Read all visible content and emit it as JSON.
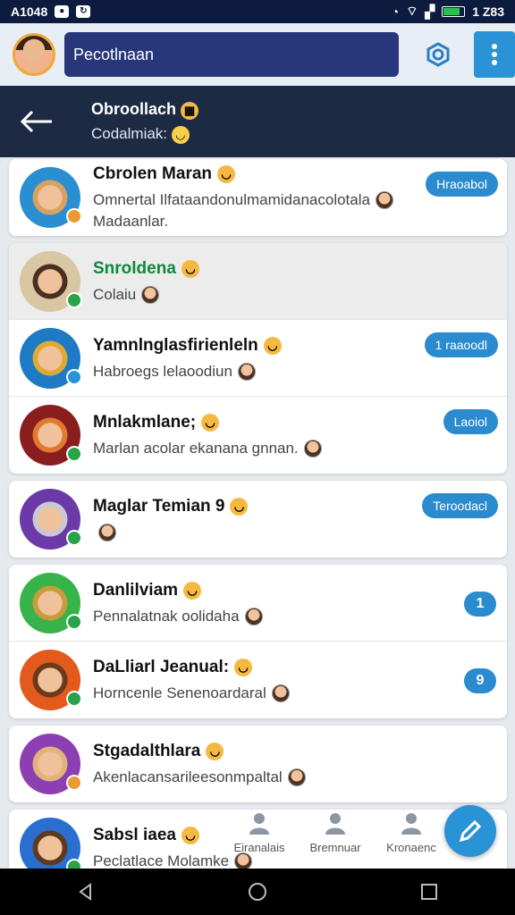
{
  "status_bar": {
    "time": "A1048",
    "right_text": "1 Z83"
  },
  "top_bar": {
    "search_value": "Pecotlnaan"
  },
  "sub_header": {
    "title": "Obroollach",
    "subtitle": "Codalmiak:"
  },
  "groups": [
    [
      {
        "name": "Cbrolen Maran",
        "preview": "Omnertal Ilfataandonulmamidanacolotala",
        "second_line": "Madaanlar.",
        "pill": "Hraoabol",
        "avatar_colors": [
          "#2a8fd0",
          "#d8a160"
        ],
        "badge": "#e99a33"
      }
    ],
    [
      {
        "name": "Snroldena",
        "preview": "Colaiu",
        "selected": true,
        "green": true,
        "avatar_colors": [
          "#d9c6a3",
          "#4a3020"
        ],
        "badge": "#2aa24a"
      },
      {
        "name": "Yamnlnglasfirienleln",
        "preview": "Habroegs lelaoodiun",
        "pill": "1 raaoodl",
        "avatar_colors": [
          "#1e7ac4",
          "#e0a933"
        ],
        "badge": "#2a93d5"
      },
      {
        "name": "Mnlakmlane;",
        "preview": "Marlan acolar ekanana gnnan.",
        "pill": "Laoiol",
        "avatar_colors": [
          "#8a1e1e",
          "#e07a30"
        ],
        "badge": "#2aa24a"
      }
    ],
    [
      {
        "name": "Maglar Temian 9",
        "preview": "",
        "pill": "Teroodacl",
        "avatar_colors": [
          "#6c3aa8",
          "#c9c9d4"
        ],
        "badge": "#2aa24a"
      }
    ],
    [
      {
        "name": "Danlilviam",
        "preview": "Pennalatnak oolidaha",
        "pill": "1",
        "pill_round": true,
        "avatar_colors": [
          "#38b24a",
          "#c79c3b"
        ],
        "badge": "#2aa24a"
      },
      {
        "name": "DaLliarl Jeanual:",
        "preview": "Horncenle Senenoardaral",
        "pill": "9",
        "pill_round": true,
        "avatar_colors": [
          "#e25a1c",
          "#6b3a1c"
        ],
        "badge": "#2aa24a"
      }
    ],
    [
      {
        "name": "Stgadalthlara",
        "preview": "Akenlacansarileesonmpaltal",
        "avatar_colors": [
          "#8b3fb2",
          "#e3b27a"
        ],
        "badge": "#e99a33"
      }
    ],
    [
      {
        "name": "Sabsl iaea",
        "preview": "Peclatlace Molamke",
        "avatar_colors": [
          "#2a6fd0",
          "#5c3a22"
        ],
        "badge": "#2aa24a"
      }
    ]
  ],
  "bottom_nav": [
    {
      "label": "Eiranalais",
      "icon": "person-icon"
    },
    {
      "label": "Bremnuar",
      "icon": "briefcase-icon"
    },
    {
      "label": "Kronaenc",
      "icon": "contacts-icon"
    }
  ],
  "fab": {
    "icon": "compose-icon"
  }
}
